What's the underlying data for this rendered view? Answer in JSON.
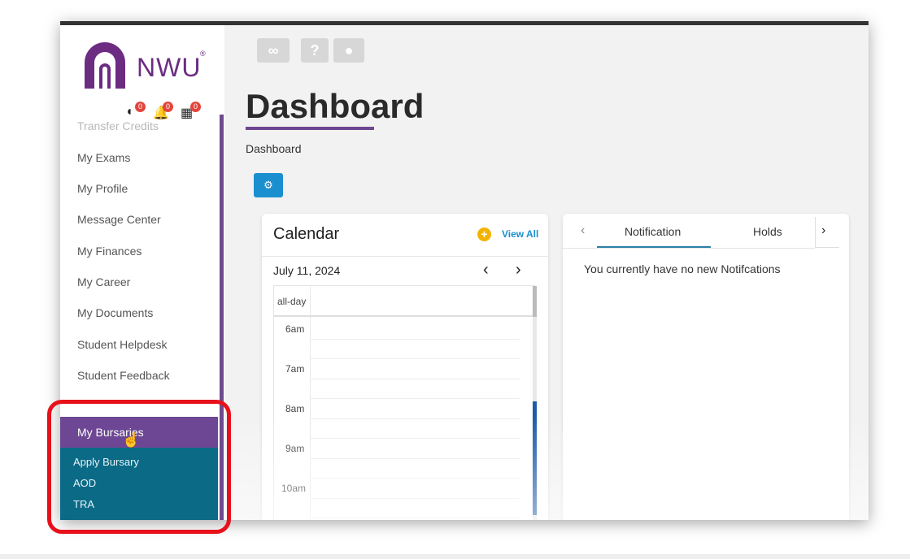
{
  "brand": {
    "logo_text": "NWU",
    "registered": "®",
    "colors": {
      "purple": "#6b2c82",
      "active_menu": "#6d4793",
      "submenu": "#0b6a86",
      "accent_blue": "#1a8fd0",
      "highlight_red": "#e8101a"
    }
  },
  "header_badges": [
    {
      "icon": "alert-icon",
      "count": "0"
    },
    {
      "icon": "bell-icon",
      "count": "0"
    },
    {
      "icon": "calendar-grid-icon",
      "count": "0"
    }
  ],
  "sidebar": {
    "items": [
      {
        "label": "Transfer Credits"
      },
      {
        "label": "My Exams"
      },
      {
        "label": "My Profile"
      },
      {
        "label": "Message Center"
      },
      {
        "label": "My Finances"
      },
      {
        "label": "My Career"
      },
      {
        "label": "My Documents"
      },
      {
        "label": "Student Helpdesk"
      },
      {
        "label": "Student Feedback"
      }
    ],
    "active_item": "My Bursaries",
    "submenu": [
      {
        "label": "Apply Bursary"
      },
      {
        "label": "AOD"
      },
      {
        "label": "TRA"
      }
    ]
  },
  "toolbar": {
    "buttons": [
      {
        "icon": "link-icon"
      },
      {
        "icon": "help-icon",
        "glyph": "?"
      },
      {
        "icon": "user-icon"
      }
    ]
  },
  "page": {
    "title": "Dashboard",
    "breadcrumb": "Dashboard"
  },
  "calendar": {
    "title": "Calendar",
    "view_all": "View All",
    "date": "July 11, 2024",
    "all_day_label": "all-day",
    "hours": [
      "6am",
      "7am",
      "8am",
      "9am",
      "10am"
    ]
  },
  "notifications": {
    "tabs": [
      "Notification",
      "Holds"
    ],
    "empty_message": "You currently have no new Notifcations"
  }
}
